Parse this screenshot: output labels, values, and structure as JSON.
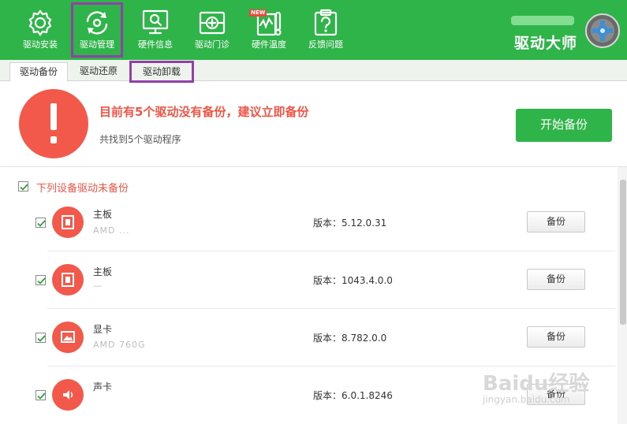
{
  "toolbar": {
    "items": [
      {
        "label": "驱动安装",
        "icon": "gear-icon"
      },
      {
        "label": "驱动管理",
        "icon": "refresh-icon"
      },
      {
        "label": "硬件信息",
        "icon": "monitor-search-icon"
      },
      {
        "label": "驱动门诊",
        "icon": "first-aid-icon"
      },
      {
        "label": "硬件温度",
        "icon": "thermometer-icon",
        "badge": "NEW"
      },
      {
        "label": "反馈问题",
        "icon": "question-icon"
      }
    ],
    "selected_index": 1,
    "brand_name": "驱动大师"
  },
  "tabs": [
    {
      "label": "驱动备份",
      "active": true
    },
    {
      "label": "驱动还原",
      "active": false
    },
    {
      "label": "驱动卸载",
      "active": false
    }
  ],
  "alert": {
    "title": "目前有5个驱动没有备份，建议立即备份",
    "subtitle": "共找到5个驱动程序",
    "button": "开始备份"
  },
  "list": {
    "header": "下列设备驱动未备份",
    "header_checked": true,
    "rows": [
      {
        "name": "主板",
        "model": "AMD ...",
        "version": "版本：5.12.0.31",
        "button": "备份",
        "checked": true,
        "icon": "motherboard-icon"
      },
      {
        "name": "主板",
        "model": "—",
        "version": "版本：1043.4.0.0",
        "button": "备份",
        "checked": true,
        "icon": "motherboard-icon"
      },
      {
        "name": "显卡",
        "model": "AMD 760G",
        "version": "版本：8.782.0.0",
        "button": "备份",
        "checked": true,
        "icon": "display-icon"
      },
      {
        "name": "声卡",
        "model": "",
        "version": "版本：6.0.1.8246",
        "button": "备份",
        "checked": true,
        "icon": "speaker-icon"
      }
    ]
  },
  "watermark": {
    "text": "Baidu经验",
    "url": "jingyan.baidu.com"
  },
  "colors": {
    "primary": "#2fb44a",
    "alert": "#f05545",
    "highlight": "#9040a8"
  }
}
